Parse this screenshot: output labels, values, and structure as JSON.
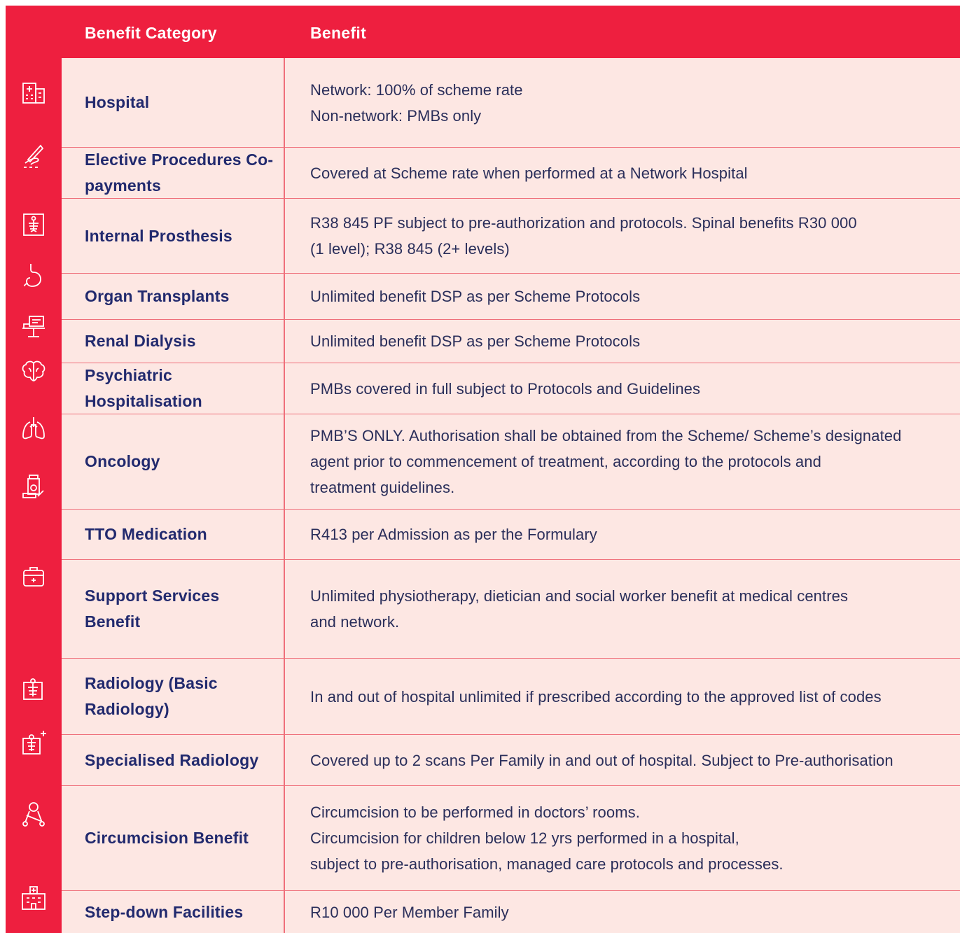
{
  "header": {
    "category_label": "Benefit Category",
    "benefit_label": "Benefit"
  },
  "rows": [
    {
      "category": "Hospital",
      "icon": "hospital-building-icon",
      "benefit": [
        "Network: 100% of scheme rate",
        "Non-network: PMBs only"
      ]
    },
    {
      "category": "Elective Procedures Co-payments",
      "icon": "scalpel-hand-icon",
      "benefit": [
        "Covered at Scheme rate when performed at a Network Hospital"
      ]
    },
    {
      "category": "Internal Prosthesis",
      "icon": "skeleton-xray-icon",
      "benefit": [
        "R38 845 PF subject to pre-authorization and protocols. Spinal benefits R30 000",
        "(1 level); R38 845 (2+ levels)"
      ]
    },
    {
      "category": "Organ Transplants",
      "icon": "stomach-organ-icon",
      "benefit": [
        "Unlimited benefit DSP as per Scheme Protocols"
      ]
    },
    {
      "category": "Renal Dialysis",
      "icon": "dialysis-machine-icon",
      "benefit": [
        "Unlimited benefit DSP as per Scheme Protocols"
      ]
    },
    {
      "category": "Psychiatric Hospitalisation",
      "icon": "brain-icon",
      "benefit": [
        "PMBs covered in full subject to Protocols and Guidelines"
      ]
    },
    {
      "category": "Oncology",
      "icon": "lungs-icon",
      "benefit": [
        "PMB’S ONLY. Authorisation shall be obtained from the Scheme/ Scheme’s designated",
        "agent prior to commencement of treatment, according to the protocols and",
        "treatment guidelines."
      ]
    },
    {
      "category": "TTO Medication",
      "icon": "medication-bottle-icon",
      "benefit": [
        "R413 per Admission as per the Formulary"
      ]
    },
    {
      "category": "Support Services Benefit",
      "icon": "first-aid-kit-icon",
      "benefit": [
        "Unlimited physiotherapy, dietician and social worker benefit at medical centres",
        "and network."
      ]
    },
    {
      "category": "Radiology (Basic Radiology)",
      "icon": "xray-icon",
      "benefit": [
        "In and out of hospital unlimited if prescribed according to the approved list of codes"
      ]
    },
    {
      "category": "Specialised Radiology",
      "icon": "xray-plus-icon",
      "benefit": [
        "Covered up to 2 scans Per Family in and out of hospital. Subject to Pre-authorisation"
      ]
    },
    {
      "category": "Circumcision Benefit",
      "icon": "scissors-icon",
      "benefit": [
        "Circumcision to be performed in doctors’ rooms.",
        "Circumcision for children below 12 yrs performed in a hospital,",
        "subject to pre-authorisation, managed care protocols and processes."
      ]
    },
    {
      "category": "Step-down Facilities",
      "icon": "facility-building-icon",
      "benefit": [
        "R10 000 Per Member Family"
      ]
    }
  ]
}
